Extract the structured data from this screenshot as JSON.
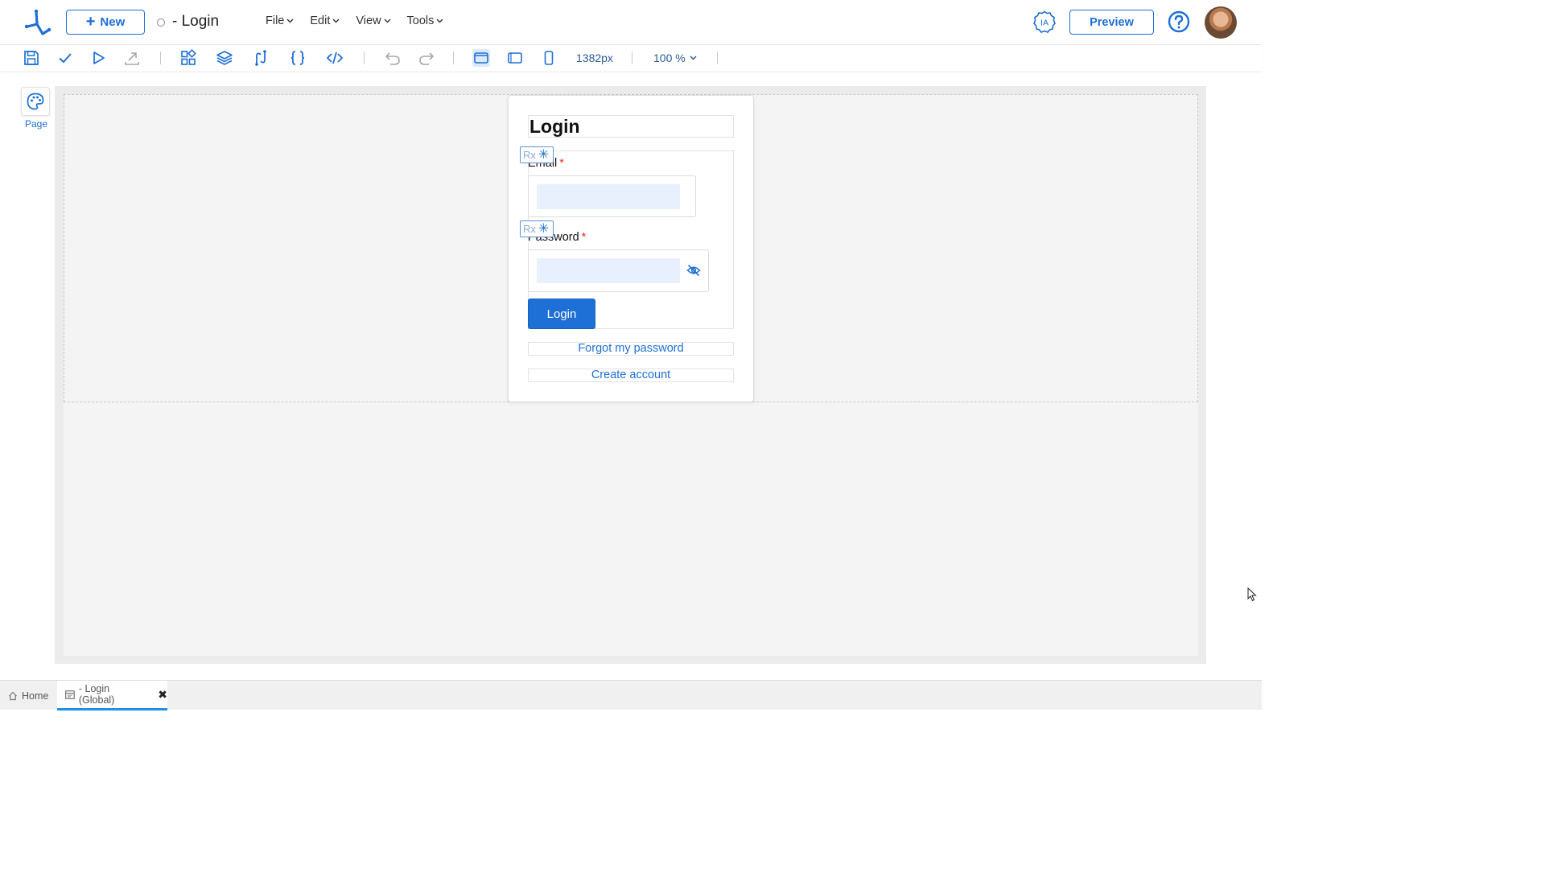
{
  "header": {
    "new_label": "New",
    "doc_title": "- Login",
    "menus": [
      {
        "label": "File"
      },
      {
        "label": "Edit"
      },
      {
        "label": "View"
      },
      {
        "label": "Tools"
      }
    ],
    "ia_label": "IA",
    "preview_label": "Preview",
    "help_icon": "question-circle-icon"
  },
  "toolbar": {
    "icons": [
      "save-icon",
      "check-icon",
      "play-icon",
      "export-icon",
      "components-icon",
      "layers-icon",
      "flow-icon",
      "braces-icon",
      "code-icon",
      "undo-icon",
      "redo-icon",
      "desktop-view-icon",
      "tablet-view-icon",
      "mobile-view-icon"
    ],
    "width_value": "1382px",
    "zoom_value": "100 %"
  },
  "left_panel": {
    "page_label": "Page"
  },
  "login_form": {
    "title": "Login",
    "email_label": "Email",
    "password_label": "Password",
    "required_mark": "*",
    "rx_label": "Rx",
    "rx_symbol": "✳",
    "login_button": "Login",
    "forgot_link": "Forgot my password",
    "create_link": "Create account"
  },
  "bottom_tabs": [
    {
      "label": "Home",
      "active": false
    },
    {
      "label": "- Login (Global)",
      "active": true
    }
  ],
  "colors": {
    "accent": "#1e6fd6",
    "required": "#e53030",
    "input_fill": "#e8f0fe"
  }
}
